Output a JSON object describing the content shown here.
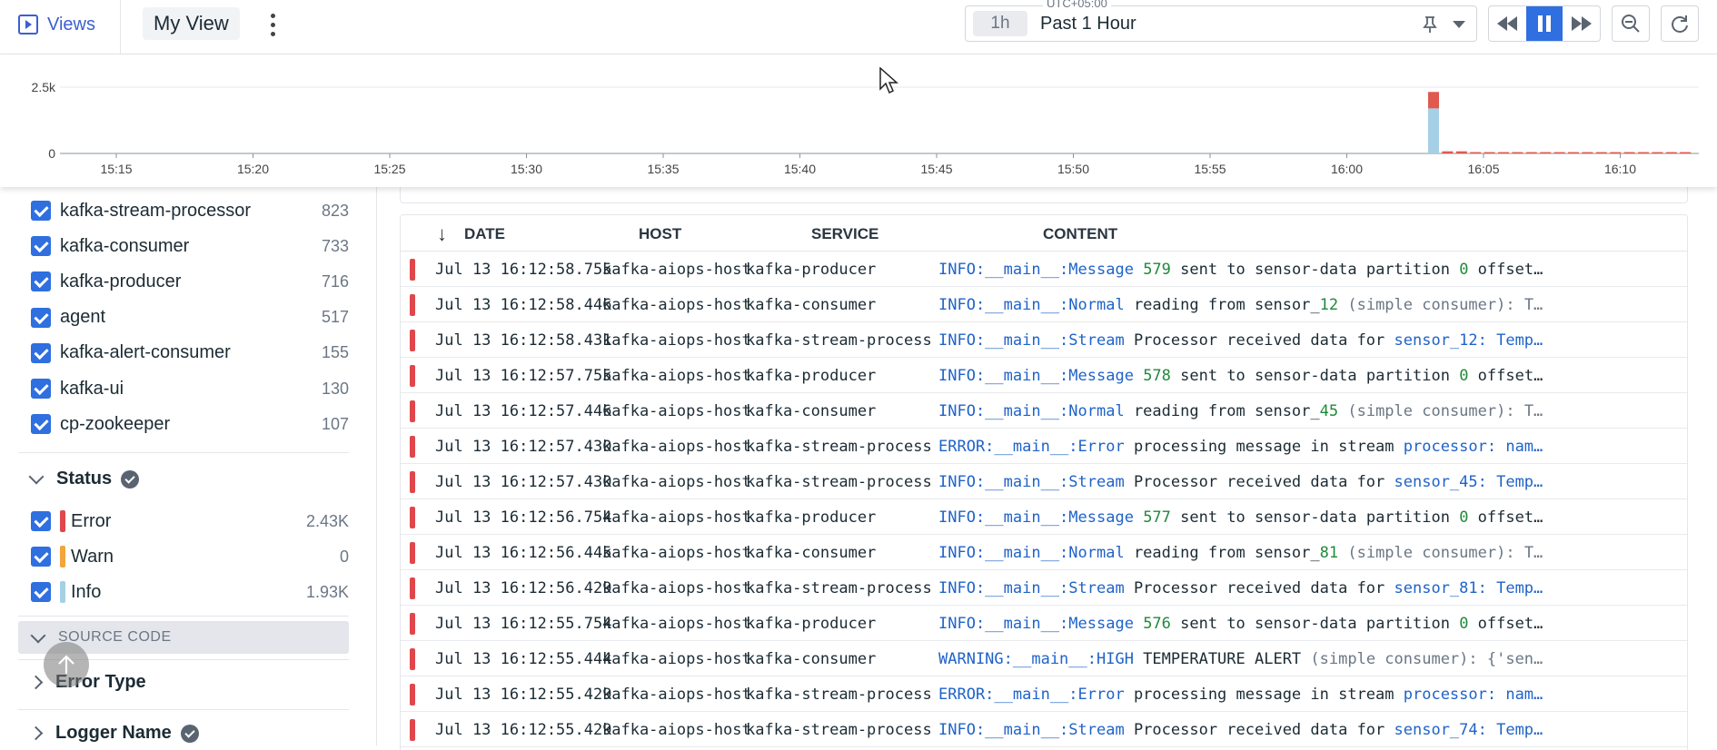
{
  "topbar": {
    "views_label": "Views",
    "view_name": "My View",
    "timezone": "UTC+05:00",
    "time_chip": "1h",
    "time_label": "Past 1 Hour"
  },
  "chart_data": {
    "type": "bar",
    "yticks": [
      "2.5k",
      "0"
    ],
    "xticks": [
      "15:15",
      "15:20",
      "15:25",
      "15:30",
      "15:35",
      "15:40",
      "15:45",
      "15:50",
      "15:55",
      "16:00",
      "16:05",
      "16:10"
    ],
    "ylim": [
      0,
      2500
    ],
    "series": [
      {
        "color": "#a5d0e6",
        "values": [
          1700,
          0,
          0,
          0,
          0,
          0,
          0,
          0,
          0,
          0,
          0,
          0,
          0,
          0,
          0,
          0,
          0,
          0,
          0
        ]
      },
      {
        "color": "#e05a4f",
        "values": [
          620,
          80,
          80,
          50,
          50,
          50,
          50,
          50,
          50,
          50,
          50,
          50,
          50,
          50,
          50,
          50,
          50,
          50,
          50
        ]
      }
    ]
  },
  "services": [
    {
      "name": "kafka-stream-processor",
      "count": "823"
    },
    {
      "name": "kafka-consumer",
      "count": "733"
    },
    {
      "name": "kafka-producer",
      "count": "716"
    },
    {
      "name": "agent",
      "count": "517"
    },
    {
      "name": "kafka-alert-consumer",
      "count": "155"
    },
    {
      "name": "kafka-ui",
      "count": "130"
    },
    {
      "name": "cp-zookeeper",
      "count": "107"
    }
  ],
  "status": {
    "title": "Status",
    "items": [
      {
        "name": "Error",
        "count": "2.43K",
        "color": "#e0474c"
      },
      {
        "name": "Warn",
        "count": "0",
        "color": "#f2a53a"
      },
      {
        "name": "Info",
        "count": "1.93K",
        "color": "#a5d0e6"
      }
    ]
  },
  "facets": {
    "source_code": "SOURCE CODE",
    "error_type": "Error Type",
    "logger_name": "Logger Name"
  },
  "table": {
    "columns": [
      "DATE",
      "HOST",
      "SERVICE",
      "CONTENT"
    ],
    "rows": [
      {
        "date": "Jul 13 16:12:58.755",
        "host": "kafka-aiops-host",
        "service": "kafka-producer",
        "content": [
          [
            "INFO:__main__:Message",
            "b"
          ],
          [
            " ",
            "k"
          ],
          [
            "579",
            "g"
          ],
          [
            " sent to sensor-data partition ",
            "k"
          ],
          [
            "0",
            "g"
          ],
          [
            " offset…",
            "k"
          ]
        ]
      },
      {
        "date": "Jul 13 16:12:58.446",
        "host": "kafka-aiops-host",
        "service": "kafka-consumer",
        "content": [
          [
            "INFO:__main__:Normal",
            "b"
          ],
          [
            " reading from sensor_",
            "k"
          ],
          [
            "12",
            "g"
          ],
          [
            " (simple consumer): T…",
            "m"
          ]
        ]
      },
      {
        "date": "Jul 13 16:12:58.431",
        "host": "kafka-aiops-host",
        "service": "kafka-stream-processor",
        "content": [
          [
            "INFO:__main__:Stream",
            "b"
          ],
          [
            " Processor received data for ",
            "k"
          ],
          [
            "sensor_12: Temp…",
            "b"
          ]
        ]
      },
      {
        "date": "Jul 13 16:12:57.755",
        "host": "kafka-aiops-host",
        "service": "kafka-producer",
        "content": [
          [
            "INFO:__main__:Message",
            "b"
          ],
          [
            " ",
            "k"
          ],
          [
            "578",
            "g"
          ],
          [
            " sent to sensor-data partition ",
            "k"
          ],
          [
            "0",
            "g"
          ],
          [
            " offset…",
            "k"
          ]
        ]
      },
      {
        "date": "Jul 13 16:12:57.446",
        "host": "kafka-aiops-host",
        "service": "kafka-consumer",
        "content": [
          [
            "INFO:__main__:Normal",
            "b"
          ],
          [
            " reading from sensor_",
            "k"
          ],
          [
            "45",
            "g"
          ],
          [
            " (simple consumer): T…",
            "m"
          ]
        ]
      },
      {
        "date": "Jul 13 16:12:57.430",
        "host": "kafka-aiops-host",
        "service": "kafka-stream-processor",
        "content": [
          [
            "ERROR:__main__:Error",
            "b"
          ],
          [
            " processing message in stream ",
            "k"
          ],
          [
            "processor: nam…",
            "b"
          ]
        ]
      },
      {
        "date": "Jul 13 16:12:57.430",
        "host": "kafka-aiops-host",
        "service": "kafka-stream-processor",
        "content": [
          [
            "INFO:__main__:Stream",
            "b"
          ],
          [
            " Processor received data for ",
            "k"
          ],
          [
            "sensor_45: Temp…",
            "b"
          ]
        ]
      },
      {
        "date": "Jul 13 16:12:56.754",
        "host": "kafka-aiops-host",
        "service": "kafka-producer",
        "content": [
          [
            "INFO:__main__:Message",
            "b"
          ],
          [
            " ",
            "k"
          ],
          [
            "577",
            "g"
          ],
          [
            " sent to sensor-data partition ",
            "k"
          ],
          [
            "0",
            "g"
          ],
          [
            " offset…",
            "k"
          ]
        ]
      },
      {
        "date": "Jul 13 16:12:56.445",
        "host": "kafka-aiops-host",
        "service": "kafka-consumer",
        "content": [
          [
            "INFO:__main__:Normal",
            "b"
          ],
          [
            " reading from sensor_",
            "k"
          ],
          [
            "81",
            "g"
          ],
          [
            " (simple consumer): T…",
            "m"
          ]
        ]
      },
      {
        "date": "Jul 13 16:12:56.429",
        "host": "kafka-aiops-host",
        "service": "kafka-stream-processor",
        "content": [
          [
            "INFO:__main__:Stream",
            "b"
          ],
          [
            " Processor received data for ",
            "k"
          ],
          [
            "sensor_81: Temp…",
            "b"
          ]
        ]
      },
      {
        "date": "Jul 13 16:12:55.754",
        "host": "kafka-aiops-host",
        "service": "kafka-producer",
        "content": [
          [
            "INFO:__main__:Message",
            "b"
          ],
          [
            " ",
            "k"
          ],
          [
            "576",
            "g"
          ],
          [
            " sent to sensor-data partition ",
            "k"
          ],
          [
            "0",
            "g"
          ],
          [
            " offset…",
            "k"
          ]
        ]
      },
      {
        "date": "Jul 13 16:12:55.444",
        "host": "kafka-aiops-host",
        "service": "kafka-consumer",
        "content": [
          [
            "WARNING:__main__:HIGH",
            "b"
          ],
          [
            " TEMPERATURE ALERT ",
            "k"
          ],
          [
            "(simple consumer): {'sen…",
            "m"
          ]
        ]
      },
      {
        "date": "Jul 13 16:12:55.429",
        "host": "kafka-aiops-host",
        "service": "kafka-stream-processor",
        "content": [
          [
            "ERROR:__main__:Error",
            "b"
          ],
          [
            " processing message in stream ",
            "k"
          ],
          [
            "processor: nam…",
            "b"
          ]
        ]
      },
      {
        "date": "Jul 13 16:12:55.429",
        "host": "kafka-aiops-host",
        "service": "kafka-stream-processor",
        "content": [
          [
            "INFO:__main__:Stream",
            "b"
          ],
          [
            " Processor received data for ",
            "k"
          ],
          [
            "sensor_74: Temp…",
            "b"
          ]
        ]
      }
    ]
  },
  "colors": {
    "accent": "#2f6fe0",
    "content_blue": "#1f63c9",
    "content_green": "#1f8a3a",
    "content_muted": "#6b7785"
  }
}
